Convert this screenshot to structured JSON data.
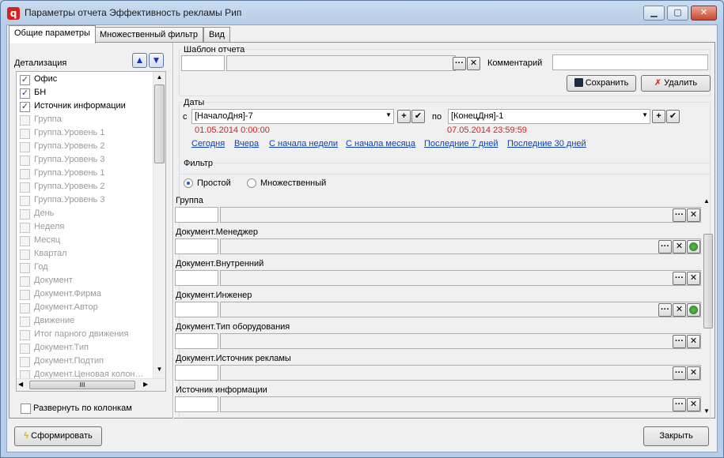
{
  "window": {
    "title": "Параметры отчета Эффективность рекламы Рип",
    "app_icon": "app-logo-icon"
  },
  "tabs": [
    "Общие параметры",
    "Множественный фильтр",
    "Вид"
  ],
  "detail": {
    "label": "Детализация",
    "items": [
      {
        "label": "Офис",
        "checked": true
      },
      {
        "label": "БН",
        "checked": true
      },
      {
        "label": "Источник информации",
        "checked": true
      },
      {
        "label": "Группа",
        "checked": false
      },
      {
        "label": "Группа.Уровень 1",
        "checked": false
      },
      {
        "label": "Группа.Уровень 2",
        "checked": false
      },
      {
        "label": "Группа.Уровень 3",
        "checked": false
      },
      {
        "label": "Группа.Уровень 1",
        "checked": false
      },
      {
        "label": "Группа.Уровень 2",
        "checked": false
      },
      {
        "label": "Группа.Уровень 3",
        "checked": false
      },
      {
        "label": "День",
        "checked": false
      },
      {
        "label": "Неделя",
        "checked": false
      },
      {
        "label": "Месяц",
        "checked": false
      },
      {
        "label": "Квартал",
        "checked": false
      },
      {
        "label": "Год",
        "checked": false
      },
      {
        "label": "Документ",
        "checked": false
      },
      {
        "label": "Документ.Фирма",
        "checked": false
      },
      {
        "label": "Документ.Автор",
        "checked": false
      },
      {
        "label": "Движение",
        "checked": false
      },
      {
        "label": "Итог парного движения",
        "checked": false
      },
      {
        "label": "Документ.Тип",
        "checked": false
      },
      {
        "label": "Документ.Подтип",
        "checked": false
      },
      {
        "label": "Документ.Ценовая колон…",
        "checked": false
      }
    ],
    "hscroll_label": "III",
    "expand_label": "Развернуть по колонкам"
  },
  "template": {
    "label": "Шаблон отчета",
    "comment_label": "Комментарий",
    "browse": "···",
    "clear": "✕",
    "save_label": "Сохранить",
    "delete_label": "Удалить"
  },
  "dates": {
    "label": "Даты",
    "from_label": "с",
    "from_value": "[НачалоДня]-7",
    "from_resolved": "01.05.2014 0:00:00",
    "to_label": "по",
    "to_value": "[КонецДня]-1",
    "to_resolved": "07.05.2014 23:59:59",
    "quick": [
      "Сегодня",
      "Вчера",
      "С начала недели",
      "С начала месяца",
      "Последние 7 дней",
      "Последние 30 дней"
    ]
  },
  "filter": {
    "label": "Фильтр",
    "mode_simple": "Простой",
    "mode_multi": "Множественный",
    "fields": [
      {
        "label": "Группа",
        "extra": false
      },
      {
        "label": "Документ.Менеджер",
        "extra": true
      },
      {
        "label": "Документ.Внутренний",
        "extra": false
      },
      {
        "label": "Документ.Инженер",
        "extra": true
      },
      {
        "label": "Документ.Тип оборудования",
        "extra": false
      },
      {
        "label": "Документ.Источник рекламы",
        "extra": false
      },
      {
        "label": "Источник информации",
        "extra": false
      }
    ]
  },
  "footer": {
    "run_label": "Сформировать",
    "close_label": "Закрыть"
  },
  "colors": {
    "link": "#0b3fbf",
    "date_resolved": "#d31f1f",
    "accent": "#1d5ac1"
  }
}
